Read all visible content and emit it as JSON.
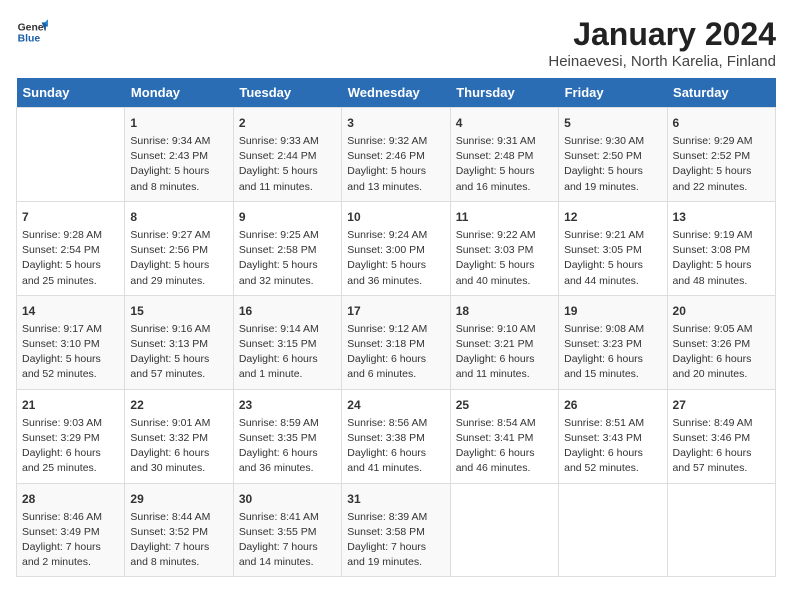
{
  "header": {
    "logo_general": "General",
    "logo_blue": "Blue",
    "title": "January 2024",
    "subtitle": "Heinaevesi, North Karelia, Finland"
  },
  "days_of_week": [
    "Sunday",
    "Monday",
    "Tuesday",
    "Wednesday",
    "Thursday",
    "Friday",
    "Saturday"
  ],
  "weeks": [
    [
      {
        "day": "",
        "info": ""
      },
      {
        "day": "1",
        "info": "Sunrise: 9:34 AM\nSunset: 2:43 PM\nDaylight: 5 hours\nand 8 minutes."
      },
      {
        "day": "2",
        "info": "Sunrise: 9:33 AM\nSunset: 2:44 PM\nDaylight: 5 hours\nand 11 minutes."
      },
      {
        "day": "3",
        "info": "Sunrise: 9:32 AM\nSunset: 2:46 PM\nDaylight: 5 hours\nand 13 minutes."
      },
      {
        "day": "4",
        "info": "Sunrise: 9:31 AM\nSunset: 2:48 PM\nDaylight: 5 hours\nand 16 minutes."
      },
      {
        "day": "5",
        "info": "Sunrise: 9:30 AM\nSunset: 2:50 PM\nDaylight: 5 hours\nand 19 minutes."
      },
      {
        "day": "6",
        "info": "Sunrise: 9:29 AM\nSunset: 2:52 PM\nDaylight: 5 hours\nand 22 minutes."
      }
    ],
    [
      {
        "day": "7",
        "info": "Sunrise: 9:28 AM\nSunset: 2:54 PM\nDaylight: 5 hours\nand 25 minutes."
      },
      {
        "day": "8",
        "info": "Sunrise: 9:27 AM\nSunset: 2:56 PM\nDaylight: 5 hours\nand 29 minutes."
      },
      {
        "day": "9",
        "info": "Sunrise: 9:25 AM\nSunset: 2:58 PM\nDaylight: 5 hours\nand 32 minutes."
      },
      {
        "day": "10",
        "info": "Sunrise: 9:24 AM\nSunset: 3:00 PM\nDaylight: 5 hours\nand 36 minutes."
      },
      {
        "day": "11",
        "info": "Sunrise: 9:22 AM\nSunset: 3:03 PM\nDaylight: 5 hours\nand 40 minutes."
      },
      {
        "day": "12",
        "info": "Sunrise: 9:21 AM\nSunset: 3:05 PM\nDaylight: 5 hours\nand 44 minutes."
      },
      {
        "day": "13",
        "info": "Sunrise: 9:19 AM\nSunset: 3:08 PM\nDaylight: 5 hours\nand 48 minutes."
      }
    ],
    [
      {
        "day": "14",
        "info": "Sunrise: 9:17 AM\nSunset: 3:10 PM\nDaylight: 5 hours\nand 52 minutes."
      },
      {
        "day": "15",
        "info": "Sunrise: 9:16 AM\nSunset: 3:13 PM\nDaylight: 5 hours\nand 57 minutes."
      },
      {
        "day": "16",
        "info": "Sunrise: 9:14 AM\nSunset: 3:15 PM\nDaylight: 6 hours\nand 1 minute."
      },
      {
        "day": "17",
        "info": "Sunrise: 9:12 AM\nSunset: 3:18 PM\nDaylight: 6 hours\nand 6 minutes."
      },
      {
        "day": "18",
        "info": "Sunrise: 9:10 AM\nSunset: 3:21 PM\nDaylight: 6 hours\nand 11 minutes."
      },
      {
        "day": "19",
        "info": "Sunrise: 9:08 AM\nSunset: 3:23 PM\nDaylight: 6 hours\nand 15 minutes."
      },
      {
        "day": "20",
        "info": "Sunrise: 9:05 AM\nSunset: 3:26 PM\nDaylight: 6 hours\nand 20 minutes."
      }
    ],
    [
      {
        "day": "21",
        "info": "Sunrise: 9:03 AM\nSunset: 3:29 PM\nDaylight: 6 hours\nand 25 minutes."
      },
      {
        "day": "22",
        "info": "Sunrise: 9:01 AM\nSunset: 3:32 PM\nDaylight: 6 hours\nand 30 minutes."
      },
      {
        "day": "23",
        "info": "Sunrise: 8:59 AM\nSunset: 3:35 PM\nDaylight: 6 hours\nand 36 minutes."
      },
      {
        "day": "24",
        "info": "Sunrise: 8:56 AM\nSunset: 3:38 PM\nDaylight: 6 hours\nand 41 minutes."
      },
      {
        "day": "25",
        "info": "Sunrise: 8:54 AM\nSunset: 3:41 PM\nDaylight: 6 hours\nand 46 minutes."
      },
      {
        "day": "26",
        "info": "Sunrise: 8:51 AM\nSunset: 3:43 PM\nDaylight: 6 hours\nand 52 minutes."
      },
      {
        "day": "27",
        "info": "Sunrise: 8:49 AM\nSunset: 3:46 PM\nDaylight: 6 hours\nand 57 minutes."
      }
    ],
    [
      {
        "day": "28",
        "info": "Sunrise: 8:46 AM\nSunset: 3:49 PM\nDaylight: 7 hours\nand 2 minutes."
      },
      {
        "day": "29",
        "info": "Sunrise: 8:44 AM\nSunset: 3:52 PM\nDaylight: 7 hours\nand 8 minutes."
      },
      {
        "day": "30",
        "info": "Sunrise: 8:41 AM\nSunset: 3:55 PM\nDaylight: 7 hours\nand 14 minutes."
      },
      {
        "day": "31",
        "info": "Sunrise: 8:39 AM\nSunset: 3:58 PM\nDaylight: 7 hours\nand 19 minutes."
      },
      {
        "day": "",
        "info": ""
      },
      {
        "day": "",
        "info": ""
      },
      {
        "day": "",
        "info": ""
      }
    ]
  ]
}
